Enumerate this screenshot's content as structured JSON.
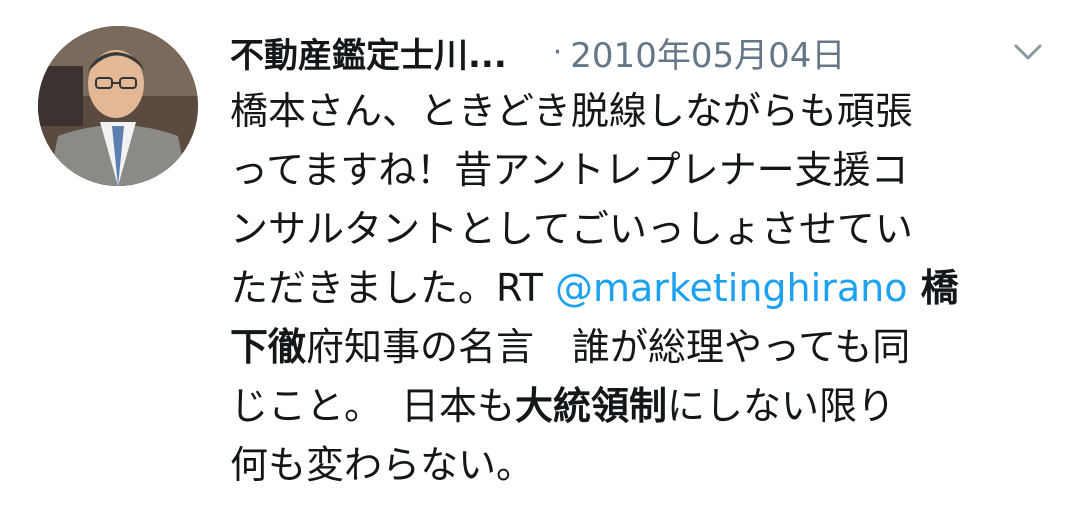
{
  "tweet": {
    "display_name": "不動産鑑定士川...",
    "separator": "·",
    "timestamp": "2010年05月04日",
    "avatar_icon": "user-photo-avatar",
    "menu_icon": "chevron-down-icon",
    "lines": {
      "l1": "橋本さん、ときどき脱線しながらも頑張",
      "l2": "ってますね！昔アントレプレナー支援コ",
      "l3": "ンサルタントとしてごいっしょさせてい",
      "l4_text": "ただきました。RT ",
      "l4_mention": "@marketinghirano",
      "l4_bold": " 橋",
      "l5_bold": "下徹",
      "l5_text": "府知事の名言　誰が総理やっても同",
      "l6_text": "じこと。　日本も",
      "l6_bold": "大統領制",
      "l6_text2": "にしない限り",
      "l7": "何も変わらない。"
    },
    "colors": {
      "text": "#14171a",
      "muted": "#657786",
      "link": "#1da1f2"
    }
  }
}
